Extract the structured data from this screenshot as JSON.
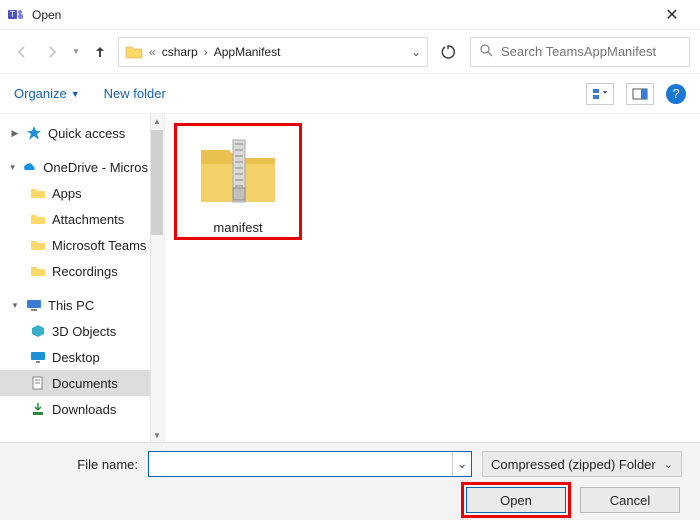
{
  "window": {
    "title": "Open"
  },
  "nav": {
    "back_enabled": false,
    "fwd_enabled": false,
    "breadcrumb": {
      "prefix": "«",
      "parts": [
        "csharp",
        "AppManifest"
      ]
    }
  },
  "search": {
    "placeholder": "Search TeamsAppManifest"
  },
  "toolbar": {
    "organize": "Organize",
    "newfolder": "New folder"
  },
  "sidebar": {
    "items": [
      {
        "label": "Quick access",
        "icon": "quick-access-icon",
        "expandable": true,
        "expanded": false
      },
      {
        "label": "OneDrive - Micros",
        "icon": "onedrive-icon",
        "expandable": true,
        "expanded": true,
        "children": [
          {
            "label": "Apps",
            "icon": "folder-icon"
          },
          {
            "label": "Attachments",
            "icon": "folder-icon"
          },
          {
            "label": "Microsoft Teams",
            "icon": "folder-icon"
          },
          {
            "label": "Recordings",
            "icon": "folder-icon"
          }
        ]
      },
      {
        "label": "This PC",
        "icon": "thispc-icon",
        "expandable": true,
        "expanded": true,
        "children": [
          {
            "label": "3D Objects",
            "icon": "3d-icon"
          },
          {
            "label": "Desktop",
            "icon": "desktop-icon"
          },
          {
            "label": "Documents",
            "icon": "documents-icon",
            "selected": true
          },
          {
            "label": "Downloads",
            "icon": "downloads-icon"
          }
        ]
      }
    ]
  },
  "files": {
    "items": [
      {
        "name": "manifest",
        "type": "zip",
        "selected": true
      }
    ]
  },
  "footer": {
    "filename_label": "File name:",
    "filename_value": "",
    "filetype_label": "Compressed (zipped) Folder",
    "open": "Open",
    "cancel": "Cancel"
  }
}
